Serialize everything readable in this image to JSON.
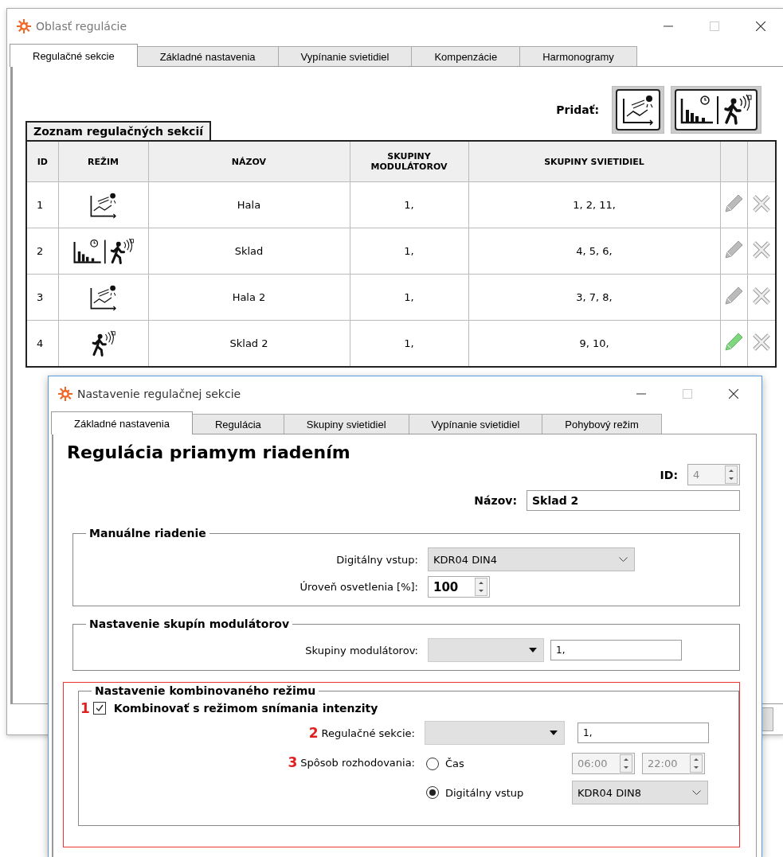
{
  "main_window": {
    "title": "Oblasť regulácie",
    "tabs": [
      {
        "label": "Regulačné sekcie",
        "selected": true
      },
      {
        "label": "Základné nastavenia",
        "selected": false
      },
      {
        "label": "Vypínanie svietidiel",
        "selected": false
      },
      {
        "label": "Kompenzácie",
        "selected": false
      },
      {
        "label": "Harmonogramy",
        "selected": false
      }
    ],
    "add_label": "Pridať:",
    "add_buttons": [
      {
        "kind": "intensity"
      },
      {
        "kind": "combined"
      }
    ],
    "list_caption": "Zoznam regulačných sekcií",
    "table": {
      "columns": [
        "ID",
        "REŽIM",
        "NÁZOV",
        "SKUPINY MODULÁTOROV",
        "SKUPINY SVIETIDIEL"
      ],
      "rows": [
        {
          "id": "1",
          "kind": "intensity",
          "name": "Hala",
          "modulator_groups": "1,",
          "light_groups": "1, 2, 11,",
          "edit_active": false
        },
        {
          "id": "2",
          "kind": "combined",
          "name": "Sklad",
          "modulator_groups": "1,",
          "light_groups": "4, 5, 6,",
          "edit_active": false
        },
        {
          "id": "3",
          "kind": "intensity",
          "name": "Hala 2",
          "modulator_groups": "1,",
          "light_groups": "3, 7, 8,",
          "edit_active": false
        },
        {
          "id": "4",
          "kind": "motion",
          "name": "Sklad 2",
          "modulator_groups": "1,",
          "light_groups": "9, 10,",
          "edit_active": true
        }
      ]
    }
  },
  "dialog": {
    "title": "Nastavenie regulačnej sekcie",
    "tabs": [
      {
        "label": "Základné nastavenia",
        "selected": true
      },
      {
        "label": "Regulácia",
        "selected": false
      },
      {
        "label": "Skupiny svietidiel",
        "selected": false
      },
      {
        "label": "Vypínanie svietidiel",
        "selected": false
      },
      {
        "label": "Pohybový režim",
        "selected": false
      }
    ],
    "heading": "Regulácia priamym riadením",
    "id_label": "ID:",
    "id_value": "4",
    "id_disabled": true,
    "name_label": "Názov:",
    "name_value": "Sklad 2",
    "groups": [
      {
        "title": "Manuálne riadenie",
        "rows": [
          {
            "kind": "dropdown",
            "label": "Digitálny vstup:",
            "value": "KDR04 DIN4"
          },
          {
            "kind": "spinner",
            "label": "Úroveň osvetlenia [%]:",
            "value": "100"
          }
        ]
      },
      {
        "title": "Nastavenie skupín modulátorov",
        "rows": [
          {
            "kind": "combo_text",
            "label": "Skupiny modulátorov:",
            "text": "1,"
          }
        ]
      }
    ],
    "combined": {
      "title": "Nastavenie kombinovaného režimu",
      "highlighted": true,
      "checkbox": {
        "marker": "1",
        "label": "Kombinovať s režimom snímania intenzity",
        "checked": true
      },
      "sections": {
        "marker": "2",
        "label": "Regulačné sekcie:",
        "text": "1,"
      },
      "decision": {
        "marker": "3",
        "label": "Spôsob rozhodovania:",
        "options": [
          {
            "kind": "time",
            "label": "Čas",
            "selected": false,
            "from": "06:00",
            "to": "22:00"
          },
          {
            "kind": "dropdown",
            "label": "Digitálny vstup",
            "selected": true,
            "value": "KDR04 DIN8"
          }
        ]
      }
    }
  }
}
